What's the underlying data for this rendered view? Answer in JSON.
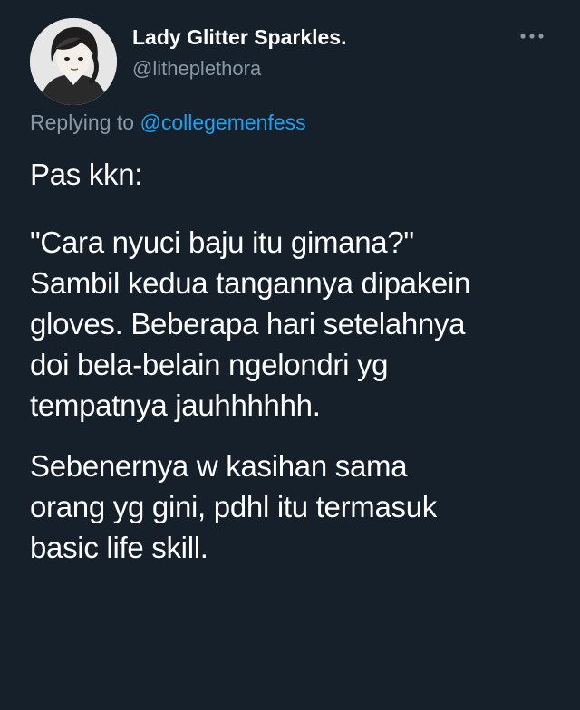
{
  "author": {
    "display_name": "Lady Glitter Sparkles.",
    "handle": "@litheplethora",
    "avatar_icon": "illustrated-girl-avatar"
  },
  "more_icon": "more-horizontal-icon",
  "reply": {
    "prefix": "Replying to ",
    "mention": "@collegemenfess"
  },
  "tweet_paragraphs": [
    "Pas kkn:",
    "\"Cara nyuci baju itu gimana?\"\nSambil kedua tangannya dipakein\ngloves. Beberapa hari setelahnya\ndoi bela-belain ngelondri yg\ntempatnya jauhhhhhh.",
    "Sebenernya w kasihan sama\norang yg gini, pdhl itu termasuk\nbasic life skill."
  ],
  "colors": {
    "background": "#15202b",
    "text_primary": "#ffffff",
    "text_secondary": "#8899a6",
    "link": "#1da1f2"
  }
}
